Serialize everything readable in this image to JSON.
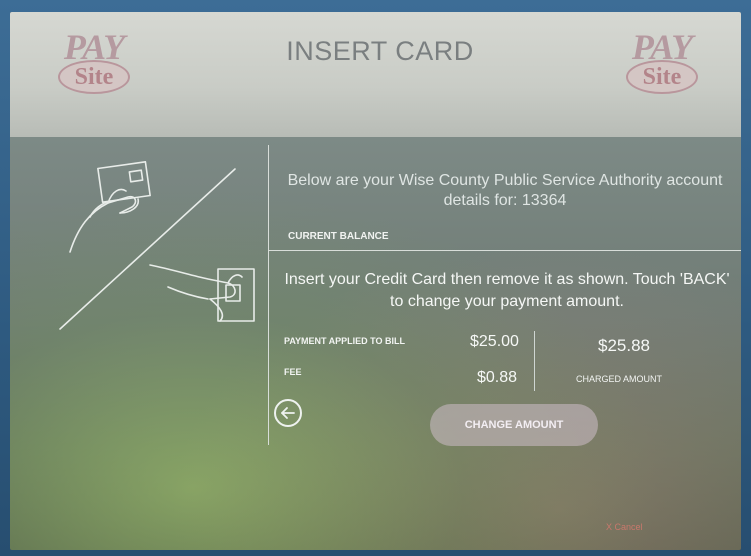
{
  "header": {
    "title": "INSERT CARD",
    "logo_top": "PAY",
    "logo_bottom": "Site"
  },
  "account": {
    "intro": "Below are your Wise County Public Service Authority account details for: 13364",
    "current_balance_label": "CURRENT BALANCE"
  },
  "payment": {
    "instructions": "Insert your Credit Card then remove it as shown. Touch 'BACK' to change your payment amount.",
    "applied_label": "PAYMENT APPLIED TO BILL",
    "applied_amount": "$25.00",
    "fee_label": "FEE",
    "fee_amount": "$0.88",
    "charged_amount": "$25.88",
    "charged_label": "CHARGED AMOUNT"
  },
  "buttons": {
    "change_amount": "CHANGE AMOUNT",
    "cancel": "X Cancel"
  },
  "icons": {
    "back": "back-arrow-icon",
    "illustration": "insert-card-illustration-icon"
  },
  "colors": {
    "header_bg": "#c9ccc6",
    "button_bg": "#cdbec8",
    "logo_accent": "#b3848a"
  }
}
